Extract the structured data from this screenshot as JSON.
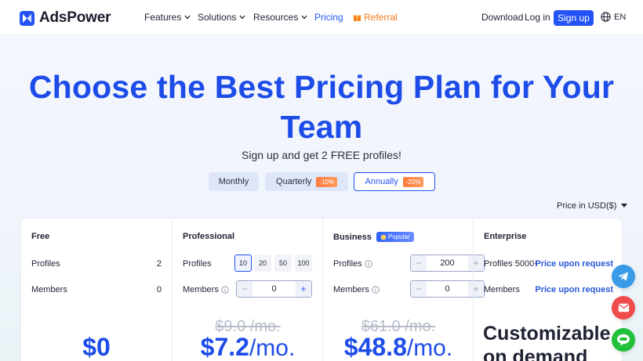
{
  "brand": {
    "name": "AdsPower",
    "color": "#2353f5"
  },
  "nav": {
    "features": "Features",
    "solutions": "Solutions",
    "resources": "Resources",
    "pricing": "Pricing",
    "referral": "Referral",
    "download": "Download",
    "login": "Log in",
    "signup": "Sign up",
    "lang": "EN"
  },
  "hero": {
    "title_line1": "Choose the Best Pricing Plan for Your",
    "title_line2": "Team",
    "subtitle": "Sign up and get 2 FREE profiles!"
  },
  "billing": {
    "monthly": "Monthly",
    "quarterly": "Quarterly",
    "quarterly_discount": "-10%",
    "annually": "Annually",
    "annually_discount": "-20%",
    "selected": "Annually"
  },
  "currency": "Price in USD($)",
  "plans": {
    "free": {
      "name": "Free",
      "profiles_label": "Profiles",
      "profiles_value": "2",
      "members_label": "Members",
      "members_value": "0",
      "price": "$0"
    },
    "professional": {
      "name": "Professional",
      "profiles_label": "Profiles",
      "profile_presets": [
        "10",
        "20",
        "50",
        "100"
      ],
      "members_label": "Members",
      "members_value": "0",
      "old_price": "$9.0 /mo.",
      "price": "$7.2",
      "per": "/mo."
    },
    "business": {
      "name": "Business",
      "badge": "Popular",
      "profiles_label": "Profiles",
      "profiles_value": "200",
      "members_label": "Members",
      "members_value": "0",
      "old_price": "$61.0 /mo.",
      "price": "$48.8",
      "per": "/mo."
    },
    "enterprise": {
      "name": "Enterprise",
      "profiles_label": "Profiles 5000+",
      "profiles_value": "Price upon request",
      "members_label": "Members",
      "members_value": "Price upon request",
      "custom_line1": "Customizable",
      "custom_line2": "on demand"
    }
  },
  "steppers": {
    "minus": "−",
    "plus": "+"
  },
  "floating": [
    "telegram-icon",
    "mail-icon",
    "line-icon"
  ]
}
